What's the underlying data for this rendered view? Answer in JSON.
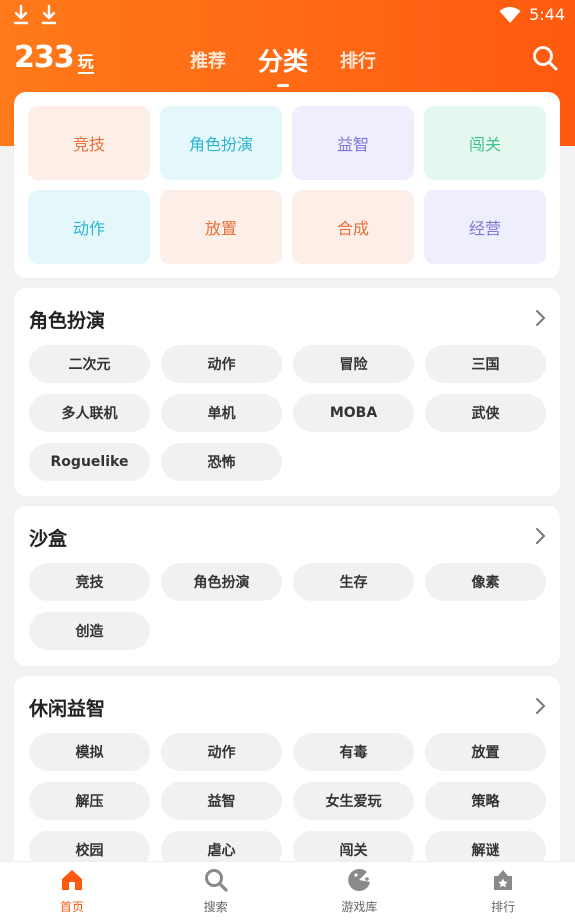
{
  "status": {
    "time": "5:44"
  },
  "brand": {
    "logo_number": "233",
    "logo_suffix": "玩"
  },
  "top_tabs": [
    {
      "label": "推荐"
    },
    {
      "label": "分类"
    },
    {
      "label": "排行"
    }
  ],
  "top_tabs_active_index": 1,
  "categories": [
    {
      "label": "竞技",
      "bg": "#fdeee8",
      "fg": "#e8703a"
    },
    {
      "label": "角色扮演",
      "bg": "#e4f7fb",
      "fg": "#2ab6d0"
    },
    {
      "label": "益智",
      "bg": "#eeeefc",
      "fg": "#7b7ad8"
    },
    {
      "label": "闯关",
      "bg": "#e5f8f0",
      "fg": "#3cc48a"
    },
    {
      "label": "动作",
      "bg": "#e4f7fb",
      "fg": "#2ab6d0"
    },
    {
      "label": "放置",
      "bg": "#fdeee8",
      "fg": "#e8703a"
    },
    {
      "label": "合成",
      "bg": "#fdeee8",
      "fg": "#e8703a"
    },
    {
      "label": "经营",
      "bg": "#eeeefc",
      "fg": "#7b7ad8"
    }
  ],
  "sections": [
    {
      "title": "角色扮演",
      "tags": [
        "二次元",
        "动作",
        "冒险",
        "三国",
        "多人联机",
        "单机",
        "MOBA",
        "武侠",
        "Roguelike",
        "恐怖"
      ]
    },
    {
      "title": "沙盒",
      "tags": [
        "竞技",
        "角色扮演",
        "生存",
        "像素",
        "创造"
      ]
    },
    {
      "title": "休闲益智",
      "tags": [
        "模拟",
        "动作",
        "有毒",
        "放置",
        "解压",
        "益智",
        "女生爱玩",
        "策略",
        "校园",
        "虐心",
        "闯关",
        "解谜"
      ]
    }
  ],
  "bottom_nav": [
    {
      "label": "首页",
      "icon": "home-icon"
    },
    {
      "label": "搜索",
      "icon": "search-icon"
    },
    {
      "label": "游戏库",
      "icon": "game-library-icon"
    },
    {
      "label": "排行",
      "icon": "ranking-icon"
    }
  ],
  "bottom_nav_active_index": 0,
  "colors": {
    "accent": "#ff5a10",
    "header_start": "#ff7a1a"
  }
}
